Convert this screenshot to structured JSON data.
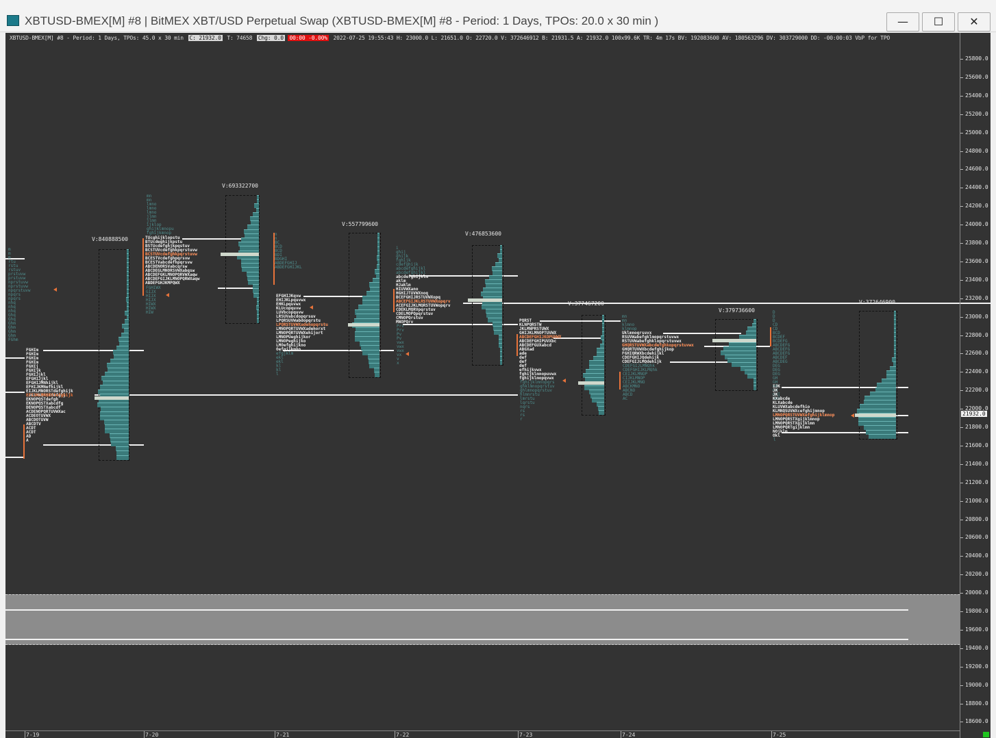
{
  "window": {
    "title": "XBTUSD-BMEX[M]  #8 | BitMEX XBT/USD Perpetual Swap (XBTUSD-BMEX[M]  #8 - Period: 1 Days, TPOs: 20.0 x 30 min  )",
    "minimize_icon": "minimize-icon",
    "maximize_icon": "maximize-icon",
    "close_icon": "close-icon",
    "minimize_glyph": "—",
    "maximize_glyph": "☐",
    "close_glyph": "✕"
  },
  "infobar": {
    "symbol": "XBTUSD-BMEX[M]  #8 - Period: 1 Days, TPOs: 45.0 x 30 min",
    "close": "C: 21932.0",
    "ticks": "T: 74658",
    "change": "Chg: 0.0",
    "alert": "00:00  -0.00%",
    "stats": "2022-07-25 19:55:43 H: 23000.0 L: 21651.0 O: 22720.0 V: 372646912 B: 21931.5 A: 21932.0 100x99.6K TR: 4m 17s BV: 192083600 AV: 180563296 DV: 303729000 DD: -00:00:03 VbP for TPO"
  },
  "price_axis": {
    "labels": [
      "25800.0",
      "25600.0",
      "25400.0",
      "25200.0",
      "25000.0",
      "24800.0",
      "24600.0",
      "24400.0",
      "24200.0",
      "24000.0",
      "23800.0",
      "23600.0",
      "23400.0",
      "23200.0",
      "23000.0",
      "22800.0",
      "22600.0",
      "22400.0",
      "22200.0",
      "22000.0",
      "21800.0",
      "21600.0",
      "21400.0",
      "21200.0",
      "21000.0",
      "20800.0",
      "20600.0",
      "20400.0",
      "20200.0",
      "20000.0",
      "19800.0",
      "19600.0",
      "19400.0",
      "19200.0",
      "19000.0",
      "18800.0",
      "18600.0"
    ],
    "last_price": "21932.0"
  },
  "date_axis": {
    "labels": [
      "7-19",
      "7-20",
      "7-21",
      "7-22",
      "7-23",
      "7-24",
      "7-25"
    ]
  },
  "volumes": {
    "v720": "V:840888500",
    "v721": "V:693322700",
    "v722": "V:557799600",
    "v723": "V:476853600",
    "v724": "V:377467200",
    "v725a": "V:379736600",
    "v725b": "V:372646900"
  },
  "colors": {
    "chart_bg": "#333333",
    "profile_fill": "#3a7a7a",
    "tpo_text": "#f2f2f2",
    "tpo_tail": "#4f8f8f",
    "open_range": "#e8733a",
    "poc": "#cfd8cc",
    "status": "#1fc41f"
  },
  "tpo": {
    "d719": {
      "tail": "m\nm\nm\nrtu\nrstu\nrstuv\nprstuvw\nprstuvw\nnprstuvw\nnprstuvw\nnpqrstuvw\nnpqrs\nnpqrs\nnhq\nnhq\nnhq\nGhq\nGhq\nGhm\nGhm\nGhm\nGhm\nFGhm",
      "body": "FGHIm\nFGHIm\nFGHIm\nFGHIm\nFGHIj\nFGHIjk\nFGHIJjkl\nEFGHIJjkl\nEFGHIJMNhijkl\nEFHIJKMNefhijkl\nEIJKLMNORSTdefghijk\nEJKLMNQRSTdefghj\nEKNOPQSTdefgh\nEKNOPQSTXabcdfg\nDENOPQSTXabcdf\nACDENOPQRTUVWXac\nACDEOTUVWX\nABCDOTUVW\nABCDTV\nACDT\nACDT\nAD\nA",
      "open_row": "EFIJKLMNQRSTefghijk"
    },
    "d720": {
      "tail": "mn\nmn\nlmno\nlmno\nlmno\njlmn\njlmn\nijklop\nghijklmnopu\nfghijkmnop",
      "body": "TUcghijklopstu\nBTUcdeghijkpstu\nBSTUcdefghjkpqstuv\nBCSTUVcdefghkpqrstuvw\nBCSTUVcdefghkpqrstuvw\nBCESTVcdefghpqrsvw\nBCESTVabcdefhpqrsvw\nABCDENORSVabcqrsw\nABCDEGLMNORSVWXabqsw\nABCDEFGKLMNOPQRVWXaqw\nABCDEFGIJKLMNOPQRWXaqw\nABDEFGHJKMPQWX",
      "tail2": "FGHIWX\nGIJX\nHIJX\nHIJX\nHIWX\nHIWX\nHIW",
      "open_row": "BCSTUVcdefghkpqrstuvw"
    },
    "d721": {
      "tail": "n\nn\nBC\nBCD\nBCD\nBDI\nBDGHI\nABDEFGHIJ\nABDEFGHIJKL",
      "body": "EFGHIJKqvw\nEHIJKLpquvwx\nEHKLpquvwx\nKLUcopquvw\nLUVbcopquvw\nLRSUVabcdopqrsuv\nLPQRSUVWabdopqrstu\nLPQRSTUVWXadehopqrstu\nLMNOPQRTUVWXadehorxt\nLMNOPQRTUVWXehijort\nLMNOPUeghijkor\nLMNOPeghijko\nLMOefghijkno\nOefgijkmno",
      "tail2": "efgjklm\nekl\nekl\nkl\nkl\nl",
      "open_row": "LPQRSTUVWXadehopqrstu"
    },
    "d722": {
      "tail": "i\nghij\nghijk\nfghijk\ncdefghijk\nabcdefghijkl\nabcdefghijkl",
      "body": "abcdefghijklm\naklm\nHJaklm\nHIUVWXano\nHGHIJTUVWXnoq\nBCEFGHIJRSTUVWXopq\nABCEFGIJKLRSTUVWXopqrv\nACEFGIJKLMQRSTUVWopqrv\nCDEKLMQRVpqrstuv\nCDELMOPQpqrstuv\nCMNOPQrstuv\nMNOPQrv",
      "tail2": "Prv\nPrv\nPv\nPv\nvwx\nvwx\nvwx\nvx\nv\nx",
      "open_row": "ABCEFGIJKLRSTUVWXopqrv"
    },
    "d723": {
      "body": "PQRST\nKLNPQRSTW\nJKLMNPRSTUWX\nGHIJKLMNOPTUVWX\nABCDEFGHIJKOPUVWX\nABCDEFGHIPUVXbc\nABCDEFGUXabcd\nABGXad\nade\ndef\ndef\ndef\nefhijkvwx\nfghijklmnopuvwx\nfghijklmopqvwx",
      "tail2": "fghijklmnopqrs\nghklmnopqrstuv\nghlmnopqrstuv\nhlmnrstu\nlmrstu\nlqrstu\nnqrs\nrs\nrs\nr",
      "open_row": "ABCDEFGHIJKOPUVWX"
    },
    "d724": {
      "tail": "mn\nmn\nklmno\nklmnop",
      "body": "Uklmnoqrsuvx\nRSUVWabefgklmopqrstuvwx\nRSTUVWabefghklopqrstuvwx\nGHQRSTUVWXabcdefghkopqrstuvwx\nGHQRTUVWXbcdefghijkop\nFGHIQRWXbcdehijkl\nCDEFGHIJQdehijk\nCDEFGIJLMQdehijk",
      "tail2": "CDEFGIJLMNQhk\nCDEFGHIJKLMQhk\nCEIJKLMNOP\nCIJKLMNOP\nCEIJKLMNO\nABCKMNO\nABCNO\nABCD\nAC",
      "open_row": "GHQRSTUVWXabcdefghkopqrstuvwx"
    },
    "d725": {
      "tail": "D\nD\nD\nCD\nCD\nBCD\nBCDEF\nBCDEFG\nABCDEFG\nABCDEFG\nABCDEFG\nABCDEF\nABCDEG\nDEG\nDEG\nDEG\nGH\nGH\nGH\nGH\nGHI\nGHI",
      "body": "IJK\nJK\nJK\nKXabcde\nKLXabcde\nKLUVWXabcdefhio\nKLMNQSUVWXcefghijmnop\nLMNOPQRSTUVWXefghijklmnop\nLMNOPQRSTXgijklmnop\nLMNOPQRSTXgijklmn\nLMNOPQRTgijklmn\nNOjklm\nOkl",
      "tail2": "l",
      "open_row": "LMNOPQRSTUVWXefghijklmnop"
    }
  }
}
